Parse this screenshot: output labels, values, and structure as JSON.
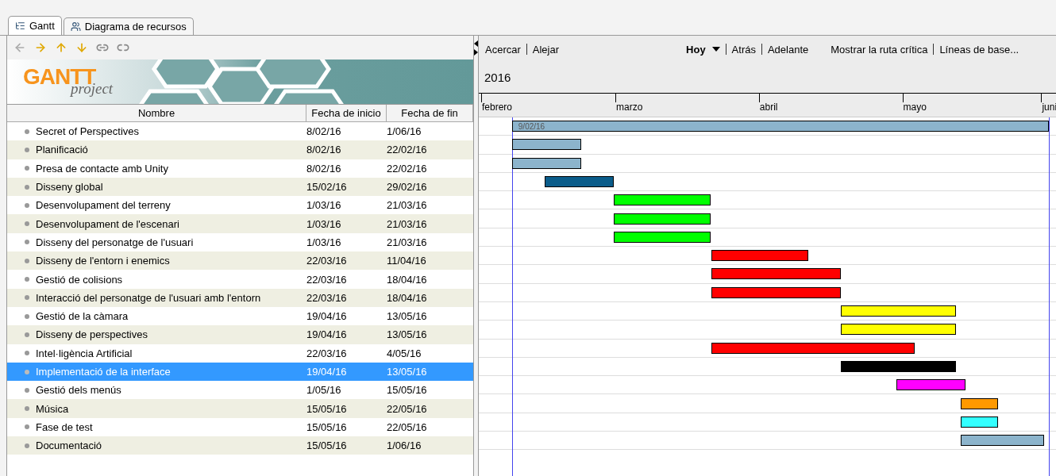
{
  "tabs": [
    {
      "label": "Gantt",
      "selected": true
    },
    {
      "label": "Diagrama de recursos",
      "selected": false
    }
  ],
  "logo": {
    "main": "GANTT",
    "sub": "project"
  },
  "table": {
    "columns": [
      "Nombre",
      "Fecha de inicio",
      "Fecha de fin"
    ],
    "rows": [
      {
        "name": "Secret of Perspectives",
        "start": "8/02/16",
        "end": "1/06/16",
        "selected": false,
        "color": "#8cb4cc"
      },
      {
        "name": "Planificació",
        "start": "8/02/16",
        "end": "22/02/16",
        "selected": false,
        "color": "#8cb4cc"
      },
      {
        "name": "Presa de contacte amb Unity",
        "start": "8/02/16",
        "end": "22/02/16",
        "selected": false,
        "color": "#8cb4cc"
      },
      {
        "name": "Disseny global",
        "start": "15/02/16",
        "end": "29/02/16",
        "selected": false,
        "color": "#0a5c8a"
      },
      {
        "name": "Desenvolupament del terreny",
        "start": "1/03/16",
        "end": "21/03/16",
        "selected": false,
        "color": "#00ff00"
      },
      {
        "name": "Desenvolupament de l'escenari",
        "start": "1/03/16",
        "end": "21/03/16",
        "selected": false,
        "color": "#00ff00"
      },
      {
        "name": "Disseny del personatge de l'usuari",
        "start": "1/03/16",
        "end": "21/03/16",
        "selected": false,
        "color": "#00ff00"
      },
      {
        "name": "Disseny de l'entorn i enemics",
        "start": "22/03/16",
        "end": "11/04/16",
        "selected": false,
        "color": "#ff0000"
      },
      {
        "name": "Gestió de colisions",
        "start": "22/03/16",
        "end": "18/04/16",
        "selected": false,
        "color": "#ff0000"
      },
      {
        "name": "Interacció del personatge de l'usuari amb l'entorn",
        "start": "22/03/16",
        "end": "18/04/16",
        "selected": false,
        "color": "#ff0000"
      },
      {
        "name": "Gestió de la càmara",
        "start": "19/04/16",
        "end": "13/05/16",
        "selected": false,
        "color": "#ffff00"
      },
      {
        "name": "Disseny de perspectives",
        "start": "19/04/16",
        "end": "13/05/16",
        "selected": false,
        "color": "#ffff00"
      },
      {
        "name": "Intel·ligència Artificial",
        "start": "22/03/16",
        "end": "4/05/16",
        "selected": false,
        "color": "#ff0000"
      },
      {
        "name": "Implementació de la interface",
        "start": "19/04/16",
        "end": "13/05/16",
        "selected": true,
        "color": "#000000"
      },
      {
        "name": "Gestió dels menús",
        "start": "1/05/16",
        "end": "15/05/16",
        "selected": false,
        "color": "#ff00ff"
      },
      {
        "name": "Música",
        "start": "15/05/16",
        "end": "22/05/16",
        "selected": false,
        "color": "#ff9900"
      },
      {
        "name": "Fase de test",
        "start": "15/05/16",
        "end": "22/05/16",
        "selected": false,
        "color": "#33ffff"
      },
      {
        "name": "Documentació",
        "start": "15/05/16",
        "end": "1/06/16",
        "selected": false,
        "color": "#8cb4cc"
      }
    ]
  },
  "timeline": {
    "toolbar_groups": [
      [
        {
          "label": "Acercar",
          "kind": "link"
        },
        {
          "label": "Alejar",
          "kind": "link"
        }
      ],
      [
        {
          "label": "Hoy",
          "kind": "dropdown"
        },
        {
          "label": "Atrás",
          "kind": "link"
        },
        {
          "label": "Adelante",
          "kind": "link"
        }
      ],
      [
        {
          "label": "Mostrar la ruta crítica",
          "kind": "link"
        },
        {
          "label": "Líneas de base...",
          "kind": "link"
        }
      ]
    ],
    "year": "2016",
    "months": [
      "febrero",
      "marzo",
      "abril",
      "mayo",
      "juni"
    ],
    "milestone_label": "9/02/16"
  }
}
